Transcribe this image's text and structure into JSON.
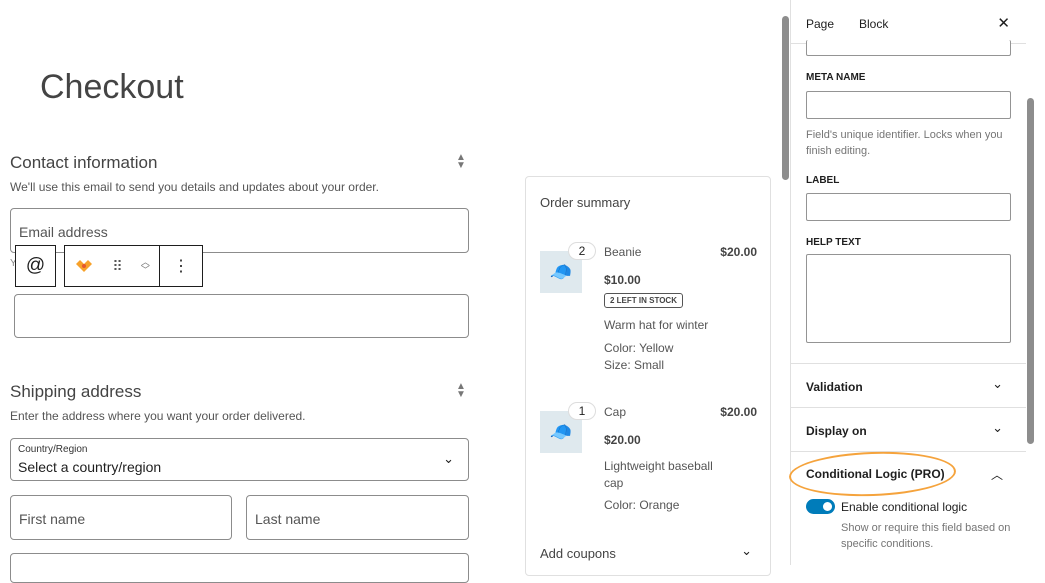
{
  "page_title": "Checkout",
  "contact": {
    "heading": "Contact information",
    "description": "We'll use this email to send you details and updates about your order.",
    "email_placeholder": "Email address",
    "hidden_hint": "Y"
  },
  "toolbar": {
    "at_icon": "@",
    "logo_icon": "brand-logo",
    "more": "⋮"
  },
  "shipping": {
    "heading": "Shipping address",
    "description": "Enter the address where you want your order delivered.",
    "country_label": "Country/Region",
    "country_value": "Select a country/region",
    "first_name": "First name",
    "last_name": "Last name"
  },
  "order_summary": {
    "heading": "Order summary",
    "items": [
      {
        "qty": "2",
        "name": "Beanie",
        "total": "$20.00",
        "price": "$10.00",
        "badge": "2 LEFT IN STOCK",
        "desc": "Warm hat for winter",
        "meta": [
          "Color: Yellow",
          "Size: Small"
        ]
      },
      {
        "qty": "1",
        "name": "Cap",
        "total": "$20.00",
        "price": "$20.00",
        "desc": "Lightweight baseball cap",
        "meta": [
          "Color: Orange"
        ]
      }
    ],
    "coupons": "Add coupons"
  },
  "sidebar": {
    "tabs": [
      "Page",
      "Block"
    ],
    "active_tab": "Block",
    "meta_name_label": "META NAME",
    "meta_name_help": "Field's unique identifier. Locks when you finish editing.",
    "label_label": "LABEL",
    "help_text_label": "HELP TEXT",
    "panels": [
      "Validation",
      "Display on",
      "Conditional Logic (PRO)"
    ],
    "toggle_label": "Enable conditional logic",
    "toggle_on": true,
    "toggle_help": "Show or require this field based on specific conditions."
  },
  "colors": {
    "accent": "#007cba",
    "highlight": "#f5a33c"
  }
}
